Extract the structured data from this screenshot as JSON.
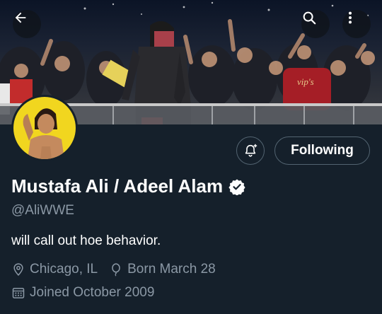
{
  "header": {
    "back_icon": "arrow-left-icon",
    "search_icon": "search-icon",
    "more_icon": "more-vertical-icon"
  },
  "banner": {
    "sign_text": "vip's"
  },
  "profile": {
    "display_name": "Mustafa Ali / Adeel Alam",
    "handle": "@AliWWE",
    "bio": "will call out hoe behavior.",
    "location": "Chicago, IL",
    "birthday": "Born March 28",
    "joined": "Joined October 2009",
    "verified": true
  },
  "actions": {
    "notify_icon": "bell-plus-icon",
    "follow_label": "Following"
  },
  "colors": {
    "background": "#15202b",
    "secondary_text": "#8b98a5",
    "border": "#536471",
    "avatar_bg": "#f1d61f"
  }
}
